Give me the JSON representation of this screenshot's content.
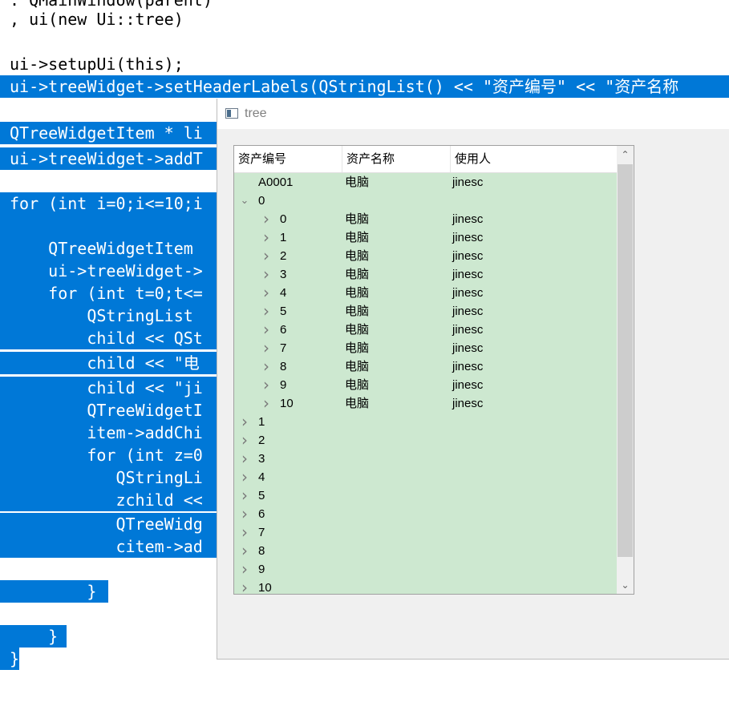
{
  "code_lines": [
    {
      "text": ": QMainWindow(parent)",
      "selected": false
    },
    {
      "text": ", ui(new Ui::tree)",
      "selected": false
    },
    {
      "text": "",
      "selected": false
    },
    {
      "text": "ui->setupUi(this);",
      "selected": false
    },
    {
      "text": "ui->treeWidget->setHeaderLabels(QStringList() << \"资产编号\" << \"资产名称",
      "selected": true
    },
    {
      "text": "",
      "selected": false
    },
    {
      "text": "QTreeWidgetItem * li",
      "selected": true
    },
    {
      "text": "ui->treeWidget->addT",
      "selected": true
    },
    {
      "text": "",
      "selected": false
    },
    {
      "text": "for (int i=0;i<=10;i",
      "selected": true
    },
    {
      "text": "",
      "selected": true
    },
    {
      "text": "    QTreeWidgetItem ",
      "selected": true
    },
    {
      "text": "    ui->treeWidget->",
      "selected": true
    },
    {
      "text": "    for (int t=0;t<=",
      "selected": true
    },
    {
      "text": "        QStringList ",
      "selected": true
    },
    {
      "text": "        child << QSt",
      "selected": true
    },
    {
      "text": "        child << \"电",
      "selected": true
    },
    {
      "text": "        child << \"ji",
      "selected": true
    },
    {
      "text": "        QTreeWidgetI",
      "selected": true
    },
    {
      "text": "        item->addChi",
      "selected": true
    },
    {
      "text": "        for (int z=0",
      "selected": true
    },
    {
      "text": "           QStringLi",
      "selected": true
    },
    {
      "text": "           zchild <<",
      "selected": true
    },
    {
      "text": "           QTreeWidg",
      "selected": true
    },
    {
      "text": "           citem->ad",
      "selected": true
    },
    {
      "text": "",
      "selected": false
    },
    {
      "text": "        }",
      "selected": true
    },
    {
      "text": "",
      "selected": false
    },
    {
      "text": "    }",
      "selected": true
    },
    {
      "text": "}",
      "selected": true
    }
  ],
  "window": {
    "title": "tree",
    "icon": "app-window-icon"
  },
  "tree": {
    "headers": [
      "资产编号",
      "资产名称",
      "使用人"
    ],
    "rows": [
      {
        "id": "A0001",
        "name": "电脑",
        "user": "jinesc",
        "level": 0,
        "arrow": ""
      },
      {
        "id": "0",
        "name": "",
        "user": "",
        "level": 0,
        "arrow": "expanded"
      },
      {
        "id": "0",
        "name": "电脑",
        "user": "jinesc",
        "level": 1,
        "arrow": "collapsed"
      },
      {
        "id": "1",
        "name": "电脑",
        "user": "jinesc",
        "level": 1,
        "arrow": "collapsed"
      },
      {
        "id": "2",
        "name": "电脑",
        "user": "jinesc",
        "level": 1,
        "arrow": "collapsed"
      },
      {
        "id": "3",
        "name": "电脑",
        "user": "jinesc",
        "level": 1,
        "arrow": "collapsed"
      },
      {
        "id": "4",
        "name": "电脑",
        "user": "jinesc",
        "level": 1,
        "arrow": "collapsed"
      },
      {
        "id": "5",
        "name": "电脑",
        "user": "jinesc",
        "level": 1,
        "arrow": "collapsed"
      },
      {
        "id": "6",
        "name": "电脑",
        "user": "jinesc",
        "level": 1,
        "arrow": "collapsed"
      },
      {
        "id": "7",
        "name": "电脑",
        "user": "jinesc",
        "level": 1,
        "arrow": "collapsed"
      },
      {
        "id": "8",
        "name": "电脑",
        "user": "jinesc",
        "level": 1,
        "arrow": "collapsed"
      },
      {
        "id": "9",
        "name": "电脑",
        "user": "jinesc",
        "level": 1,
        "arrow": "collapsed"
      },
      {
        "id": "10",
        "name": "电脑",
        "user": "jinesc",
        "level": 1,
        "arrow": "collapsed"
      },
      {
        "id": "1",
        "name": "",
        "user": "",
        "level": 0,
        "arrow": "collapsed"
      },
      {
        "id": "2",
        "name": "",
        "user": "",
        "level": 0,
        "arrow": "collapsed"
      },
      {
        "id": "3",
        "name": "",
        "user": "",
        "level": 0,
        "arrow": "collapsed"
      },
      {
        "id": "4",
        "name": "",
        "user": "",
        "level": 0,
        "arrow": "collapsed"
      },
      {
        "id": "5",
        "name": "",
        "user": "",
        "level": 0,
        "arrow": "collapsed"
      },
      {
        "id": "6",
        "name": "",
        "user": "",
        "level": 0,
        "arrow": "collapsed"
      },
      {
        "id": "7",
        "name": "",
        "user": "",
        "level": 0,
        "arrow": "collapsed"
      },
      {
        "id": "8",
        "name": "",
        "user": "",
        "level": 0,
        "arrow": "collapsed"
      },
      {
        "id": "9",
        "name": "",
        "user": "",
        "level": 0,
        "arrow": "collapsed"
      },
      {
        "id": "10",
        "name": "",
        "user": "",
        "level": 0,
        "arrow": "collapsed"
      }
    ]
  },
  "colors": {
    "selection": "#0078d7",
    "tree_background": "#cde8d0",
    "window_background": "#f0f0f0"
  }
}
